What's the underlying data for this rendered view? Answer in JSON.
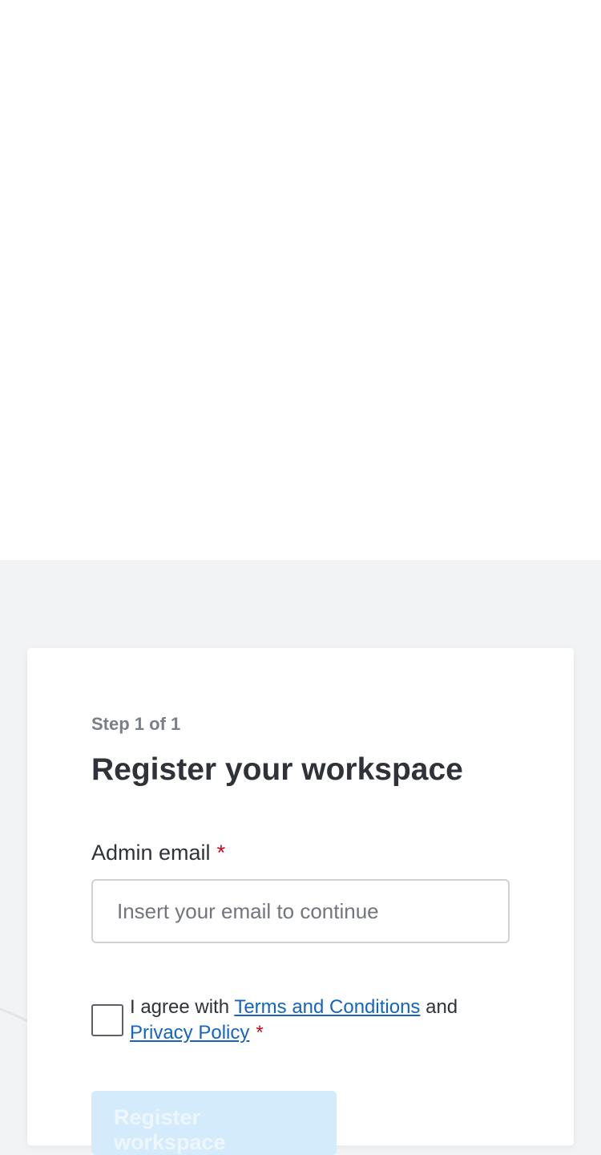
{
  "form": {
    "step": "Step 1 of 1",
    "title": "Register your workspace",
    "email_label": "Admin email",
    "required_mark": "*",
    "email_placeholder": "Insert your email to continue",
    "email_value": "",
    "agree_prefix": "I agree with ",
    "terms_link": "Terms and Conditions",
    "agree_and": " and",
    "privacy_link": "Privacy Policy",
    "submit_label": "Register workspace"
  },
  "colors": {
    "background": "#f2f3f5",
    "card": "#ffffff",
    "link": "#1565c0",
    "required": "#d0021b",
    "submit_disabled_bg": "#d3ebfb"
  }
}
